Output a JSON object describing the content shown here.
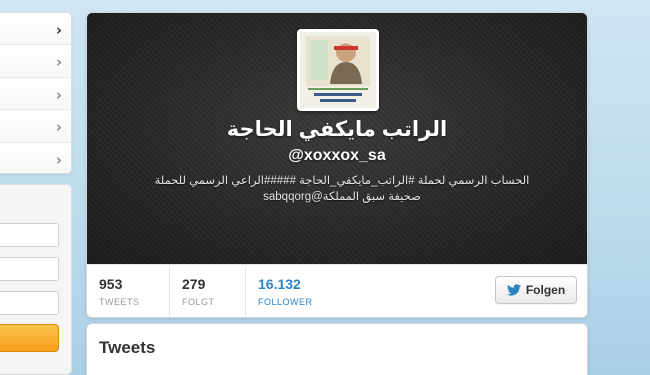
{
  "profile": {
    "display_name": "الراتب مايكفي الحاجة",
    "screen_name": "@xoxxox_sa",
    "bio": "الحساب الرسمي لحملة #الراتب_مايكفي_الحاجة #####الراعي الرسمي للحملة صحيفة سبق المملكة@sabqqorg"
  },
  "stats": {
    "tweets": {
      "value": "953",
      "label": "TWEETS"
    },
    "following": {
      "value": "279",
      "label": "FOLGT"
    },
    "followers": {
      "value": "16.132",
      "label": "FOLLOWER"
    }
  },
  "follow_button": {
    "label": "Folgen",
    "icon": "twitter-bird-icon"
  },
  "tweets_section": {
    "title": "Tweets"
  },
  "left_nav": {
    "icon": "chevron-right-icon"
  },
  "colors": {
    "accent": "#2a85c7",
    "page_bg": "#c0deed",
    "header_bg": "#262626",
    "orange_button": "#f5a020"
  }
}
